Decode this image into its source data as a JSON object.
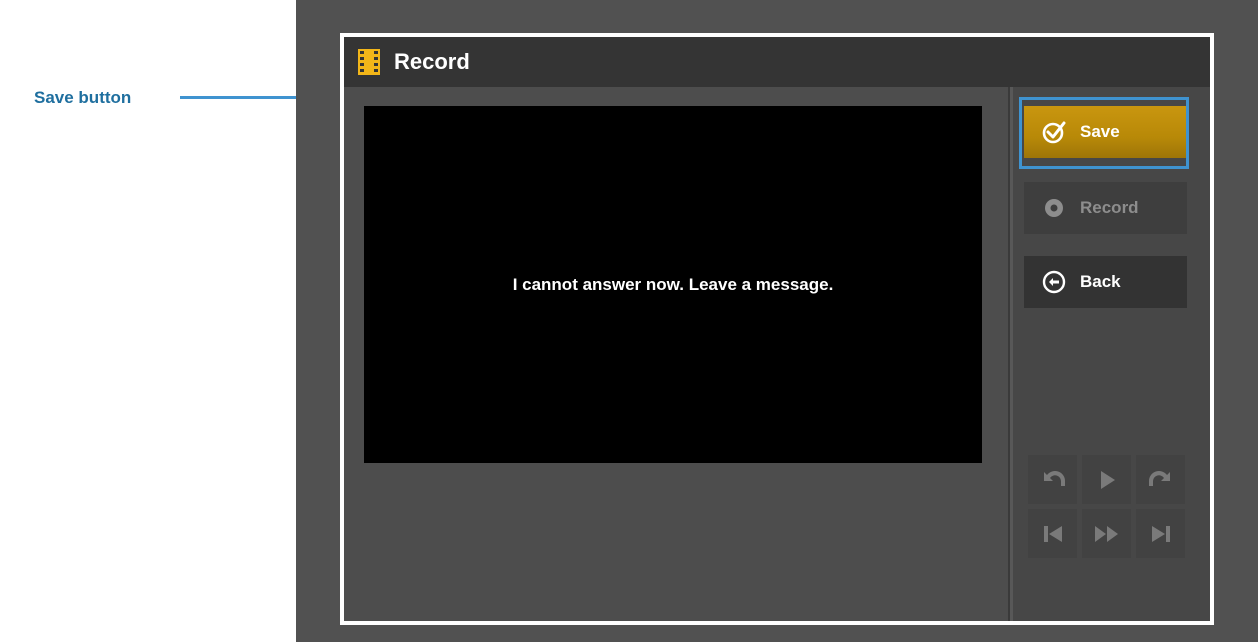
{
  "callout": {
    "label": "Save button"
  },
  "window": {
    "title": "Record",
    "icon": "film-icon"
  },
  "video": {
    "caption": "I cannot answer now. Leave a message."
  },
  "sidebar": {
    "save_label": "Save",
    "record_label": "Record",
    "back_label": "Back"
  },
  "media_controls": [
    {
      "name": "rewind-icon",
      "enabled": false
    },
    {
      "name": "play-icon",
      "enabled": false
    },
    {
      "name": "forward-icon",
      "enabled": false
    },
    {
      "name": "skip-to-start-icon",
      "enabled": false
    },
    {
      "name": "fast-forward-icon",
      "enabled": false
    },
    {
      "name": "skip-to-end-icon",
      "enabled": false
    }
  ],
  "colors": {
    "accent_gold": "#c9960f",
    "callout_blue": "#3f93d0",
    "label_blue": "#1f6f9f",
    "icon_yellow": "#f2b619"
  }
}
